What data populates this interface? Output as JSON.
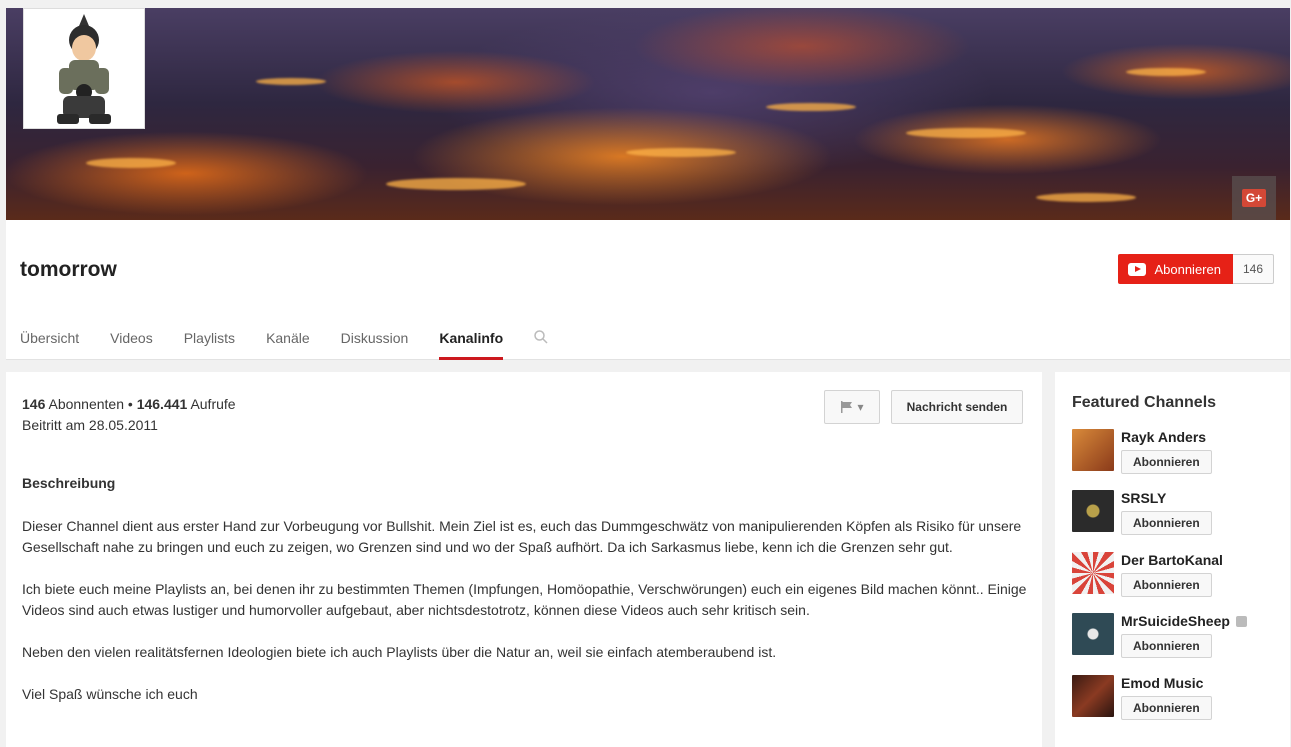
{
  "channel": {
    "title": "tomorrow",
    "gplus_label": "G+"
  },
  "subscribe": {
    "label": "Abonnieren",
    "count": "146"
  },
  "tabs": [
    {
      "label": "Übersicht"
    },
    {
      "label": "Videos"
    },
    {
      "label": "Playlists"
    },
    {
      "label": "Kanäle"
    },
    {
      "label": "Diskussion"
    },
    {
      "label": "Kanalinfo",
      "active": true
    }
  ],
  "about": {
    "subscribers_value": "146",
    "subscribers_label": "Abonnenten",
    "separator": "•",
    "views_value": "146.441",
    "views_label": "Aufrufe",
    "joined": "Beitritt am 28.05.2011",
    "flag_caret": "▾",
    "send_message": "Nachricht senden",
    "description_title": "Beschreibung",
    "description": [
      "Dieser Channel dient aus erster Hand zur Vorbeugung vor Bullshit. Mein Ziel ist es, euch das Dummgeschwätz von manipulierenden Köpfen als Risiko für unsere Gesellschaft nahe zu bringen und euch zu zeigen, wo Grenzen sind und wo der Spaß aufhört. Da ich Sarkasmus liebe, kenn ich die Grenzen sehr gut.",
      "Ich biete euch meine Playlists an, bei denen ihr zu bestimmten Themen (Impfungen, Homöopathie, Verschwörungen) euch ein eigenes Bild machen könnt.. Einige Videos sind auch etwas lustiger und humorvoller aufgebaut, aber nichtsdestotrotz, können diese Videos auch sehr kritisch sein.",
      "Neben den vielen realitätsfernen Ideologien biete ich auch Playlists über die Natur an, weil sie einfach atemberaubend ist.",
      "Viel Spaß wünsche ich euch"
    ]
  },
  "featured": {
    "title": "Featured Channels",
    "button_label": "Abonnieren",
    "channels": [
      {
        "name": "Rayk Anders",
        "thumb_color": "#c96a2a",
        "verified": false
      },
      {
        "name": "SRSLY",
        "thumb_color": "#2b2b2b",
        "verified": false
      },
      {
        "name": "Der BartoKanal",
        "thumb_color": "#d9443a",
        "verified": false
      },
      {
        "name": "MrSuicideSheep",
        "thumb_color": "#2f4a55",
        "verified": true
      },
      {
        "name": "Emod Music",
        "thumb_color": "#6b2a1e",
        "verified": false
      }
    ]
  },
  "colors": {
    "accent": "#e62117",
    "tab_underline": "#cc181e"
  }
}
